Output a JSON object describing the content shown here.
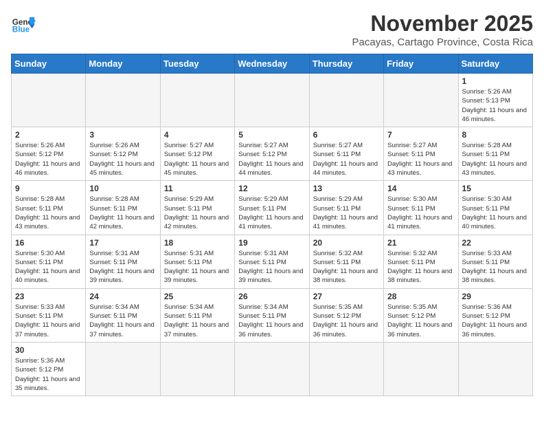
{
  "header": {
    "logo_general": "General",
    "logo_blue": "Blue",
    "month_title": "November 2025",
    "subtitle": "Pacayas, Cartago Province, Costa Rica"
  },
  "weekdays": [
    "Sunday",
    "Monday",
    "Tuesday",
    "Wednesday",
    "Thursday",
    "Friday",
    "Saturday"
  ],
  "weeks": [
    [
      {
        "day": "",
        "info": ""
      },
      {
        "day": "",
        "info": ""
      },
      {
        "day": "",
        "info": ""
      },
      {
        "day": "",
        "info": ""
      },
      {
        "day": "",
        "info": ""
      },
      {
        "day": "",
        "info": ""
      },
      {
        "day": "1",
        "info": "Sunrise: 5:26 AM\nSunset: 5:13 PM\nDaylight: 11 hours and 46 minutes."
      }
    ],
    [
      {
        "day": "2",
        "info": "Sunrise: 5:26 AM\nSunset: 5:12 PM\nDaylight: 11 hours and 46 minutes."
      },
      {
        "day": "3",
        "info": "Sunrise: 5:26 AM\nSunset: 5:12 PM\nDaylight: 11 hours and 45 minutes."
      },
      {
        "day": "4",
        "info": "Sunrise: 5:27 AM\nSunset: 5:12 PM\nDaylight: 11 hours and 45 minutes."
      },
      {
        "day": "5",
        "info": "Sunrise: 5:27 AM\nSunset: 5:12 PM\nDaylight: 11 hours and 44 minutes."
      },
      {
        "day": "6",
        "info": "Sunrise: 5:27 AM\nSunset: 5:11 PM\nDaylight: 11 hours and 44 minutes."
      },
      {
        "day": "7",
        "info": "Sunrise: 5:27 AM\nSunset: 5:11 PM\nDaylight: 11 hours and 43 minutes."
      },
      {
        "day": "8",
        "info": "Sunrise: 5:28 AM\nSunset: 5:11 PM\nDaylight: 11 hours and 43 minutes."
      }
    ],
    [
      {
        "day": "9",
        "info": "Sunrise: 5:28 AM\nSunset: 5:11 PM\nDaylight: 11 hours and 43 minutes."
      },
      {
        "day": "10",
        "info": "Sunrise: 5:28 AM\nSunset: 5:11 PM\nDaylight: 11 hours and 42 minutes."
      },
      {
        "day": "11",
        "info": "Sunrise: 5:29 AM\nSunset: 5:11 PM\nDaylight: 11 hours and 42 minutes."
      },
      {
        "day": "12",
        "info": "Sunrise: 5:29 AM\nSunset: 5:11 PM\nDaylight: 11 hours and 41 minutes."
      },
      {
        "day": "13",
        "info": "Sunrise: 5:29 AM\nSunset: 5:11 PM\nDaylight: 11 hours and 41 minutes."
      },
      {
        "day": "14",
        "info": "Sunrise: 5:30 AM\nSunset: 5:11 PM\nDaylight: 11 hours and 41 minutes."
      },
      {
        "day": "15",
        "info": "Sunrise: 5:30 AM\nSunset: 5:11 PM\nDaylight: 11 hours and 40 minutes."
      }
    ],
    [
      {
        "day": "16",
        "info": "Sunrise: 5:30 AM\nSunset: 5:11 PM\nDaylight: 11 hours and 40 minutes."
      },
      {
        "day": "17",
        "info": "Sunrise: 5:31 AM\nSunset: 5:11 PM\nDaylight: 11 hours and 39 minutes."
      },
      {
        "day": "18",
        "info": "Sunrise: 5:31 AM\nSunset: 5:11 PM\nDaylight: 11 hours and 39 minutes."
      },
      {
        "day": "19",
        "info": "Sunrise: 5:31 AM\nSunset: 5:11 PM\nDaylight: 11 hours and 39 minutes."
      },
      {
        "day": "20",
        "info": "Sunrise: 5:32 AM\nSunset: 5:11 PM\nDaylight: 11 hours and 38 minutes."
      },
      {
        "day": "21",
        "info": "Sunrise: 5:32 AM\nSunset: 5:11 PM\nDaylight: 11 hours and 38 minutes."
      },
      {
        "day": "22",
        "info": "Sunrise: 5:33 AM\nSunset: 5:11 PM\nDaylight: 11 hours and 38 minutes."
      }
    ],
    [
      {
        "day": "23",
        "info": "Sunrise: 5:33 AM\nSunset: 5:11 PM\nDaylight: 11 hours and 37 minutes."
      },
      {
        "day": "24",
        "info": "Sunrise: 5:34 AM\nSunset: 5:11 PM\nDaylight: 11 hours and 37 minutes."
      },
      {
        "day": "25",
        "info": "Sunrise: 5:34 AM\nSunset: 5:11 PM\nDaylight: 11 hours and 37 minutes."
      },
      {
        "day": "26",
        "info": "Sunrise: 5:34 AM\nSunset: 5:11 PM\nDaylight: 11 hours and 36 minutes."
      },
      {
        "day": "27",
        "info": "Sunrise: 5:35 AM\nSunset: 5:12 PM\nDaylight: 11 hours and 36 minutes."
      },
      {
        "day": "28",
        "info": "Sunrise: 5:35 AM\nSunset: 5:12 PM\nDaylight: 11 hours and 36 minutes."
      },
      {
        "day": "29",
        "info": "Sunrise: 5:36 AM\nSunset: 5:12 PM\nDaylight: 11 hours and 36 minutes."
      }
    ],
    [
      {
        "day": "30",
        "info": "Sunrise: 5:36 AM\nSunset: 5:12 PM\nDaylight: 11 hours and 35 minutes."
      },
      {
        "day": "",
        "info": ""
      },
      {
        "day": "",
        "info": ""
      },
      {
        "day": "",
        "info": ""
      },
      {
        "day": "",
        "info": ""
      },
      {
        "day": "",
        "info": ""
      },
      {
        "day": "",
        "info": ""
      }
    ]
  ]
}
